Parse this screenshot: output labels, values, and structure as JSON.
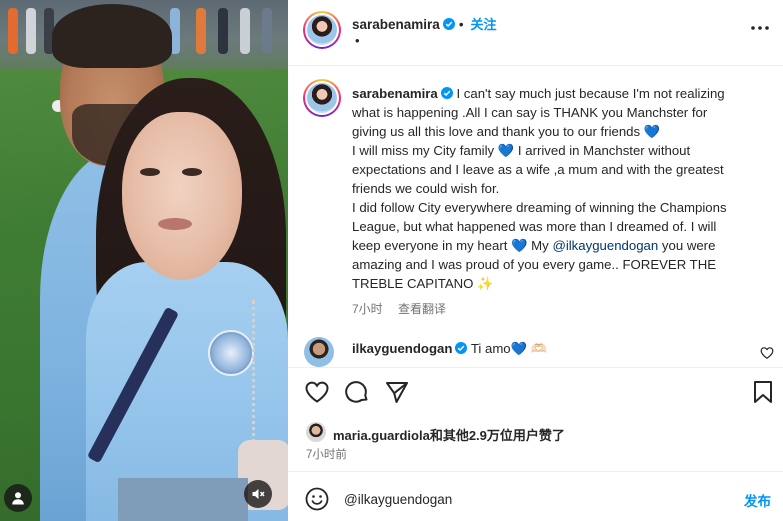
{
  "header": {
    "username": "sarabenamira",
    "follow_label": "关注",
    "subtitle": "•"
  },
  "caption": {
    "username": "sarabenamira",
    "lines": [
      "I can't say much just because I'm not realizing",
      "what is happening .All I can say is THANK you Manchster for",
      "giving us all this love and thank you to our friends",
      "I will miss my City family",
      "I arrived in Manchster without",
      "expectations and I leave as a wife ,a mum and with the greatest",
      "friends we could wish for.",
      "I did follow City everywhere dreaming of winning the Champions",
      "League, but what happened was more than I dreamed of. I will",
      "keep everyone in my heart",
      "My",
      "@ilkayguendogan",
      "you were",
      "amazing and I was proud of you every game.. FOREVER THE",
      "TREBLE CAPITANO"
    ],
    "emoji_heart": "💙",
    "emoji_sparkle": "✨",
    "time": "7小时",
    "translate_label": "查看翻译"
  },
  "comment": {
    "username": "ilkayguendogan",
    "text": "Ti amo",
    "emoji_heart": "💙",
    "emoji_hands": "🫶🏻"
  },
  "likes": {
    "username": "maria.guardiola",
    "suffix": "和其他2.9万位用户赞了"
  },
  "post_time": "7小时前",
  "input": {
    "value": "@ilkayguendogan"
  },
  "post_label": "发布",
  "icons": {
    "more": "more-options-icon",
    "like": "heart-icon",
    "comment": "comment-icon",
    "share": "share-icon",
    "save": "bookmark-icon",
    "emoji": "emoji-icon",
    "tag": "user-tag-icon",
    "mute": "mute-icon"
  },
  "colors": {
    "accent": "#0095f6",
    "mention": "#00376b",
    "verified": "#0095f6",
    "muted": "#737373"
  }
}
